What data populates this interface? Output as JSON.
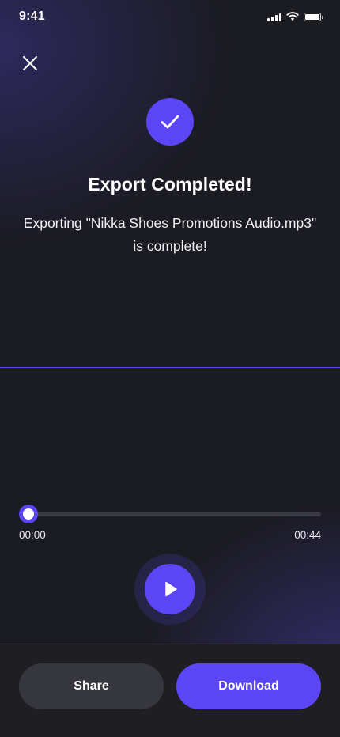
{
  "status_bar": {
    "time": "9:41",
    "icons": [
      "signal-icon",
      "wifi-icon",
      "battery-icon"
    ]
  },
  "header": {
    "close_icon": "close-icon"
  },
  "result": {
    "icon": "check-icon",
    "title": "Export Completed!",
    "message_line1": "Exporting \"Nikka Shoes Promotions Audio.mp3\"",
    "message_line2": "is complete!"
  },
  "player": {
    "current_time": "00:00",
    "total_time": "00:44",
    "progress": 0,
    "play_icon": "play-icon"
  },
  "actions": {
    "share_label": "Share",
    "download_label": "Download"
  },
  "colors": {
    "accent": "#5b45f5",
    "background": "#1b1b22",
    "secondary_button": "#36363e"
  }
}
